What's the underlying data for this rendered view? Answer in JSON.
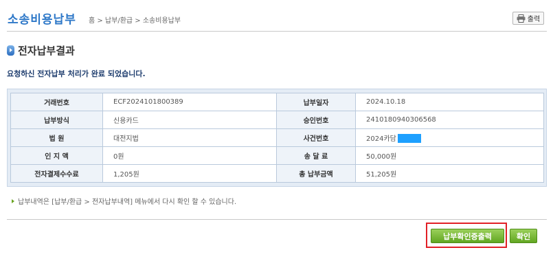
{
  "header": {
    "title": "소송비용납부",
    "breadcrumb": "홈 > 납부/환급 > 소송비용납부",
    "print_label": "출력",
    "print_icon": "printer-icon"
  },
  "section": {
    "title": "전자납부결과",
    "bullet_icon": "arrow-bullet-icon"
  },
  "result_message": "요청하신 전자납부 처리가 완료 되었습니다.",
  "payment_info": {
    "rows": [
      {
        "left_label": "거래번호",
        "left_value": "ECF2024101800389",
        "right_label": "납부일자",
        "right_value": "2024.10.18"
      },
      {
        "left_label": "납부방식",
        "left_value": "신용카드",
        "right_label": "승인번호",
        "right_value": "2410180940306568"
      },
      {
        "left_label": "법 원",
        "left_value": "대전지법",
        "right_label": "사건번호",
        "right_value": "2024카담"
      },
      {
        "left_label": "인 지 액",
        "left_value": "0원",
        "right_label": "송 달 료",
        "right_value": "50,000원"
      },
      {
        "left_label": "전자결제수수료",
        "left_value": "1,205원",
        "right_label": "총 납부금액",
        "right_value": "51,205원"
      }
    ]
  },
  "note": "납부내역은 [납부/환급 > 전자납부내역] 메뉴에서 다시 확인 할 수 있습니다.",
  "buttons": {
    "receipt_label": "납부확인증출력",
    "ok_label": "확인"
  },
  "colors": {
    "accent": "#2e78c8",
    "button_green": "#62a622",
    "highlight": "#e11f26",
    "masked": "#1ea0ff"
  }
}
